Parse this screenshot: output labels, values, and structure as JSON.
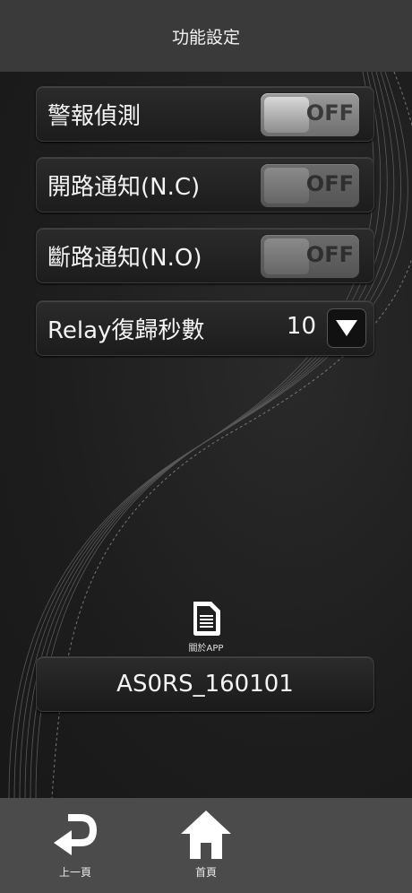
{
  "header": {
    "title": "功能設定"
  },
  "settings": {
    "alarm_detect": {
      "label": "警報偵測",
      "state": "OFF"
    },
    "open_notify": {
      "label": "開路通知(N.C)",
      "state": "OFF"
    },
    "close_notify": {
      "label": "斷路通知(N.O)",
      "state": "OFF"
    },
    "relay": {
      "label": "Relay復歸秒數",
      "value": "10"
    }
  },
  "about": {
    "label": "關於APP",
    "icon": "document-icon"
  },
  "device": {
    "name": "AS0RS_160101"
  },
  "footer": {
    "back": {
      "label": "上一頁",
      "icon": "back-arrow-icon"
    },
    "home": {
      "label": "首頁",
      "icon": "home-icon"
    }
  },
  "colors": {
    "header_bg": "#3a3a3a",
    "footer_bg": "#4b4b4b",
    "body_bg": "#1f1f1f"
  }
}
